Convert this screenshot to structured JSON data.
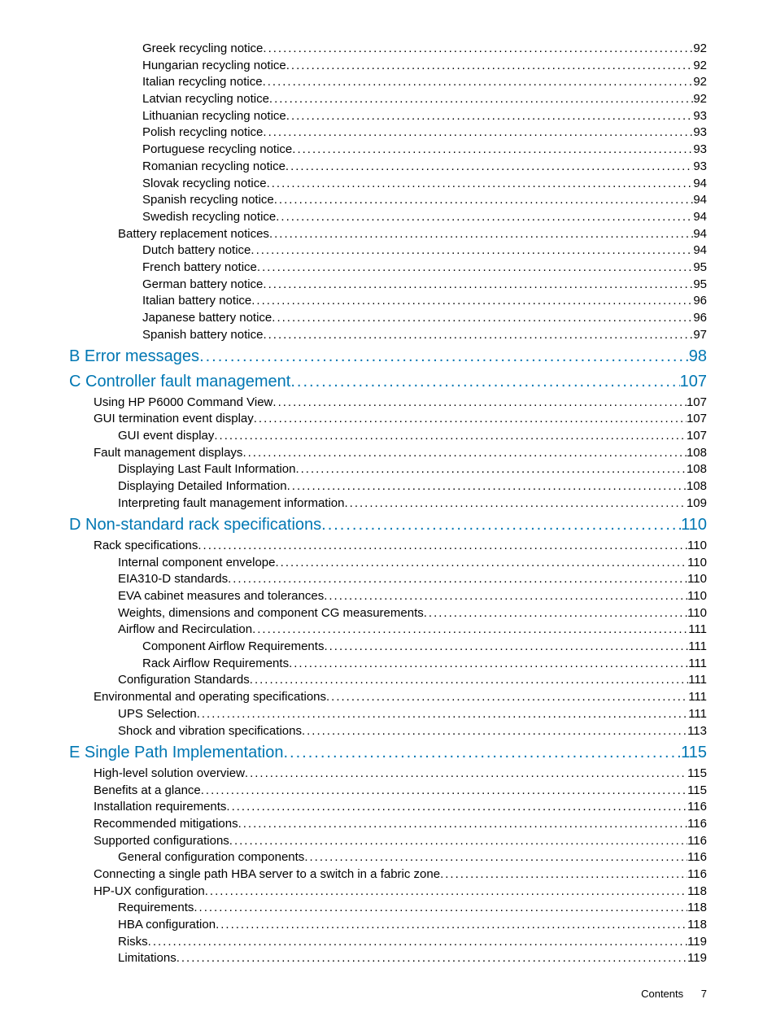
{
  "toc": [
    {
      "label": "Greek recycling notice",
      "page": "92",
      "level": 3,
      "heading": false
    },
    {
      "label": "Hungarian recycling notice",
      "page": "92",
      "level": 3,
      "heading": false
    },
    {
      "label": "Italian recycling notice",
      "page": "92",
      "level": 3,
      "heading": false
    },
    {
      "label": "Latvian recycling notice",
      "page": "92",
      "level": 3,
      "heading": false
    },
    {
      "label": "Lithuanian recycling notice",
      "page": "93",
      "level": 3,
      "heading": false
    },
    {
      "label": "Polish recycling notice",
      "page": "93",
      "level": 3,
      "heading": false
    },
    {
      "label": "Portuguese recycling notice",
      "page": "93",
      "level": 3,
      "heading": false
    },
    {
      "label": "Romanian recycling notice",
      "page": "93",
      "level": 3,
      "heading": false
    },
    {
      "label": "Slovak recycling notice",
      "page": "94",
      "level": 3,
      "heading": false
    },
    {
      "label": "Spanish recycling notice",
      "page": "94",
      "level": 3,
      "heading": false
    },
    {
      "label": "Swedish recycling notice",
      "page": "94",
      "level": 3,
      "heading": false
    },
    {
      "label": "Battery replacement notices",
      "page": "94",
      "level": 2,
      "heading": false
    },
    {
      "label": "Dutch battery notice",
      "page": "94",
      "level": 3,
      "heading": false
    },
    {
      "label": "French battery notice",
      "page": "95",
      "level": 3,
      "heading": false
    },
    {
      "label": "German battery notice",
      "page": "95",
      "level": 3,
      "heading": false
    },
    {
      "label": "Italian battery notice",
      "page": "96",
      "level": 3,
      "heading": false
    },
    {
      "label": "Japanese battery notice",
      "page": "96",
      "level": 3,
      "heading": false
    },
    {
      "label": "Spanish battery notice",
      "page": "97",
      "level": 3,
      "heading": false
    },
    {
      "label": "B Error messages",
      "page": "98",
      "level": 0,
      "heading": true
    },
    {
      "label": "C Controller fault management",
      "page": "107",
      "level": 0,
      "heading": true
    },
    {
      "label": "Using HP P6000 Command View",
      "page": "107",
      "level": 1,
      "heading": false
    },
    {
      "label": "GUI termination event display",
      "page": "107",
      "level": 1,
      "heading": false
    },
    {
      "label": "GUI event display",
      "page": "107",
      "level": 2,
      "heading": false
    },
    {
      "label": "Fault management displays",
      "page": "108",
      "level": 1,
      "heading": false
    },
    {
      "label": "Displaying Last Fault Information",
      "page": "108",
      "level": 2,
      "heading": false
    },
    {
      "label": "Displaying Detailed Information",
      "page": "108",
      "level": 2,
      "heading": false
    },
    {
      "label": "Interpreting fault management information",
      "page": "109",
      "level": 2,
      "heading": false
    },
    {
      "label": "D Non-standard rack specifications",
      "page": "110",
      "level": 0,
      "heading": true
    },
    {
      "label": "Rack specifications",
      "page": "110",
      "level": 1,
      "heading": false
    },
    {
      "label": "Internal component envelope",
      "page": "110",
      "level": 2,
      "heading": false
    },
    {
      "label": "EIA310-D standards",
      "page": "110",
      "level": 2,
      "heading": false
    },
    {
      "label": "EVA cabinet measures and tolerances",
      "page": "110",
      "level": 2,
      "heading": false
    },
    {
      "label": "Weights, dimensions and component CG measurements",
      "page": "110",
      "level": 2,
      "heading": false
    },
    {
      "label": "Airflow and Recirculation",
      "page": "111",
      "level": 2,
      "heading": false
    },
    {
      "label": "Component Airflow Requirements",
      "page": "111",
      "level": 3,
      "heading": false
    },
    {
      "label": "Rack Airflow Requirements",
      "page": "111",
      "level": 3,
      "heading": false
    },
    {
      "label": "Configuration Standards",
      "page": "111",
      "level": 2,
      "heading": false
    },
    {
      "label": "Environmental and operating specifications",
      "page": "111",
      "level": 1,
      "heading": false
    },
    {
      "label": "UPS Selection",
      "page": "111",
      "level": 2,
      "heading": false
    },
    {
      "label": "Shock and vibration specifications",
      "page": "113",
      "level": 2,
      "heading": false
    },
    {
      "label": "E Single Path Implementation",
      "page": "115",
      "level": 0,
      "heading": true
    },
    {
      "label": "High-level solution overview",
      "page": "115",
      "level": 1,
      "heading": false
    },
    {
      "label": "Benefits at a glance",
      "page": "115",
      "level": 1,
      "heading": false
    },
    {
      "label": "Installation requirements",
      "page": "116",
      "level": 1,
      "heading": false
    },
    {
      "label": "Recommended mitigations",
      "page": "116",
      "level": 1,
      "heading": false
    },
    {
      "label": "Supported configurations",
      "page": "116",
      "level": 1,
      "heading": false
    },
    {
      "label": "General configuration components",
      "page": "116",
      "level": 2,
      "heading": false
    },
    {
      "label": "Connecting a single path HBA server to a switch in a fabric zone",
      "page": "116",
      "level": 1,
      "heading": false
    },
    {
      "label": "HP-UX configuration",
      "page": "118",
      "level": 1,
      "heading": false
    },
    {
      "label": "Requirements",
      "page": "118",
      "level": 2,
      "heading": false
    },
    {
      "label": "HBA configuration",
      "page": "118",
      "level": 2,
      "heading": false
    },
    {
      "label": "Risks",
      "page": "119",
      "level": 2,
      "heading": false
    },
    {
      "label": "Limitations",
      "page": "119",
      "level": 2,
      "heading": false
    }
  ],
  "footer": {
    "label": "Contents",
    "page": "7"
  }
}
